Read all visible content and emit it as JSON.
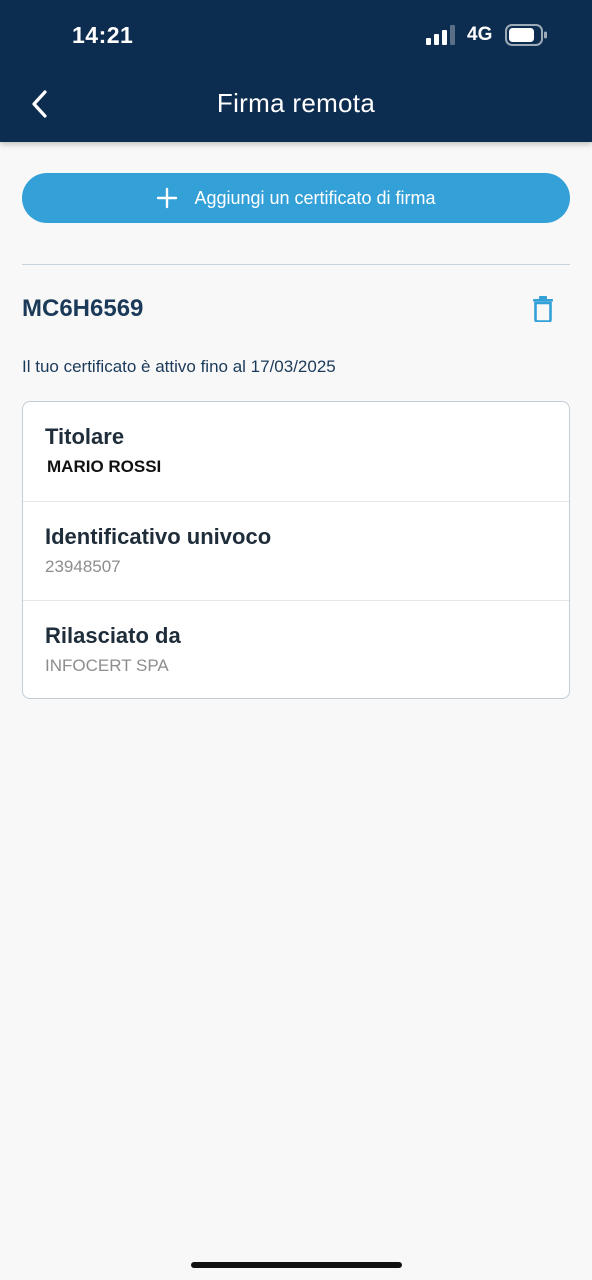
{
  "status_bar": {
    "time": "14:21",
    "network": "4G"
  },
  "header": {
    "title": "Firma remota",
    "back_icon": "chevron-left-icon"
  },
  "actions": {
    "add_certificate_label": "Aggiungi un certificato di firma",
    "add_icon": "plus-icon",
    "delete_icon": "trash-icon"
  },
  "certificate": {
    "code": "MC6H6569",
    "validity_text": "Il tuo certificato è attivo fino al 17/03/2025",
    "details": [
      {
        "label": "Titolare",
        "value": "MARIO ROSSI"
      },
      {
        "label": "Identificativo univoco",
        "value": "23948507"
      },
      {
        "label": "Rilasciato da",
        "value": "INFOCERT SPA"
      }
    ]
  },
  "colors": {
    "header_bg": "#0c2d4f",
    "accent": "#33a0d8",
    "text_dark": "#1b3a5a"
  }
}
